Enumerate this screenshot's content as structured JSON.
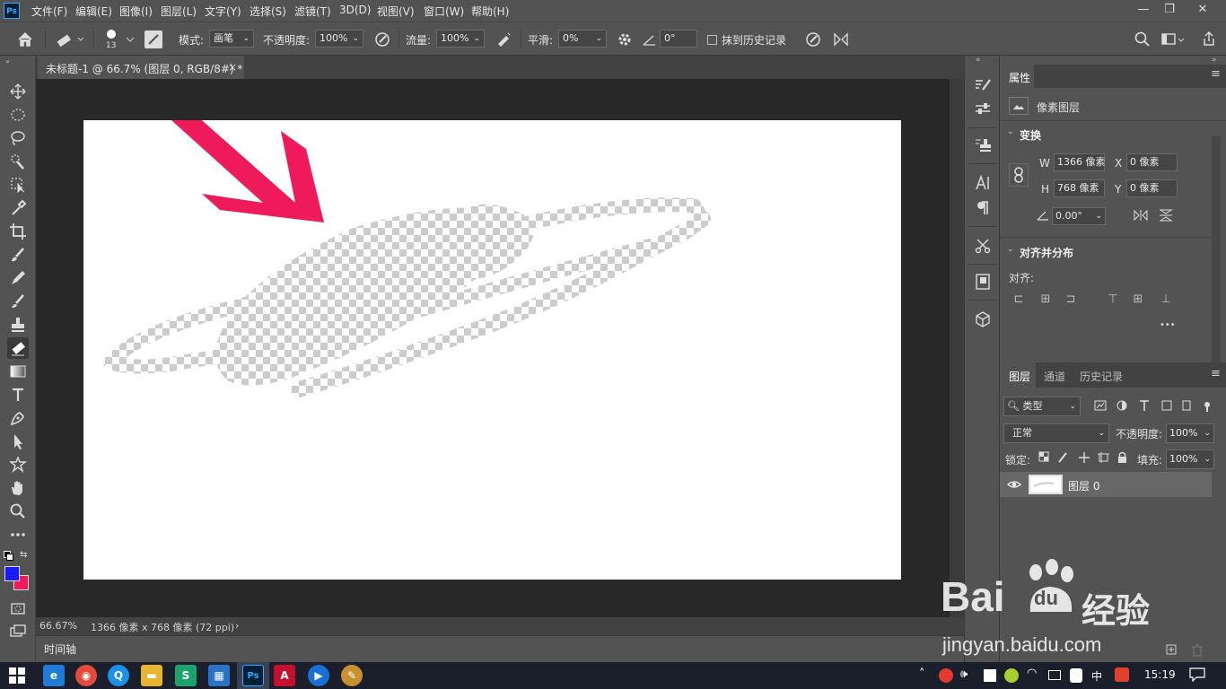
{
  "app": {
    "logo": "Ps"
  },
  "menu": [
    "文件(F)",
    "编辑(E)",
    "图像(I)",
    "图层(L)",
    "文字(Y)",
    "选择(S)",
    "滤镜(T)",
    "3D(D)",
    "视图(V)",
    "窗口(W)",
    "帮助(H)"
  ],
  "window_controls": {
    "minimize": "—",
    "restore": "❐",
    "close": "✕"
  },
  "options": {
    "brush_size": "13",
    "mode_label": "模式:",
    "mode_value": "画笔",
    "opacity_label": "不透明度:",
    "opacity_value": "100%",
    "flow_label": "流量:",
    "flow_value": "100%",
    "smooth_label": "平滑:",
    "smooth_value": "0%",
    "angle_value": "0°",
    "erase_history_label": "抹到历史记录"
  },
  "document": {
    "tab_title": "未标题-1 @ 66.7% (图层 0, RGB/8#) *",
    "tab_close": "×"
  },
  "status": {
    "zoom": "66.67%",
    "info": "1366 像素 x 768 像素 (72 ppi)",
    "arrow": "›"
  },
  "timeline": {
    "label": "时间轴"
  },
  "properties": {
    "tab": "属性",
    "layer_type": "像素图层",
    "transform_header": "变换",
    "w_label": "W",
    "w_value": "1366 像素",
    "h_label": "H",
    "h_value": "768 像素",
    "x_label": "X",
    "x_value": "0 像素",
    "y_label": "Y",
    "y_value": "0 像素",
    "angle_value": "0.00°",
    "align_header": "对齐并分布",
    "align_label": "对齐:",
    "more": "•••"
  },
  "layers_panel": {
    "tabs": [
      "图层",
      "通道",
      "历史记录"
    ],
    "filter_kind": "类型",
    "blend_mode": "正常",
    "opacity_label": "不透明度:",
    "opacity_value": "100%",
    "lock_label": "锁定:",
    "fill_label": "填充:",
    "fill_value": "100%",
    "layers": [
      {
        "name": "图层 0"
      }
    ]
  },
  "taskbar": {
    "tray_ime": "中",
    "time": "15:19"
  },
  "watermark": {
    "brand": "Bai",
    "brand2": "du",
    "suffix": "经验",
    "url": "jingyan.baidu.com"
  },
  "colors": {
    "arrow": "#ee1a5a",
    "foreground": "#1a1aff",
    "background": "#ee1a5a",
    "ps_blue": "#31a8ff"
  },
  "icons": [
    "home-icon",
    "eraser-icon",
    "airbrush-icon",
    "settings-icon",
    "angle-icon",
    "symmetry-icon",
    "search-icon",
    "workspace-icon",
    "share-icon"
  ]
}
